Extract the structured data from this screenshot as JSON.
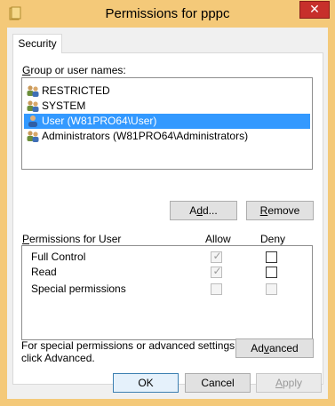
{
  "window": {
    "title": "Permissions for pppc",
    "close_glyph": "✕",
    "frame_color": "#f4c979"
  },
  "tabs": [
    {
      "label": "Security",
      "active": true
    }
  ],
  "group_label_prefix": "G",
  "group_label_rest": "roup or user names:",
  "users": [
    {
      "name": "RESTRICTED",
      "icon": "group-icon",
      "selected": false
    },
    {
      "name": "SYSTEM",
      "icon": "group-icon",
      "selected": false
    },
    {
      "name": "User (W81PRO64\\User)",
      "icon": "user-icon",
      "selected": true
    },
    {
      "name": "Administrators (W81PRO64\\Administrators)",
      "icon": "group-icon",
      "selected": false
    }
  ],
  "buttons": {
    "add_prefix": "A",
    "add_underlined": "d",
    "add_rest": "d...",
    "remove_prefix": "",
    "remove_underlined": "R",
    "remove_rest": "emove",
    "advanced_prefix": "Ad",
    "advanced_underlined": "v",
    "advanced_rest": "anced",
    "ok": "OK",
    "cancel": "Cancel",
    "apply_underlined": "A",
    "apply_rest": "pply"
  },
  "permissions": {
    "header_prefix": "",
    "header_underlined": "P",
    "header_rest": "ermissions for User",
    "allow_label": "Allow",
    "deny_label": "Deny",
    "rows": [
      {
        "name": "Full Control",
        "allow": true,
        "allow_disabled": true,
        "deny": false,
        "deny_disabled": false
      },
      {
        "name": "Read",
        "allow": true,
        "allow_disabled": true,
        "deny": false,
        "deny_disabled": false
      },
      {
        "name": "Special permissions",
        "allow": false,
        "allow_disabled": true,
        "deny": false,
        "deny_disabled": true
      }
    ]
  },
  "advanced_note_line1": "For special permissions or advanced settings,",
  "advanced_note_line2": "click Advanced.",
  "check_glyph": "✓"
}
